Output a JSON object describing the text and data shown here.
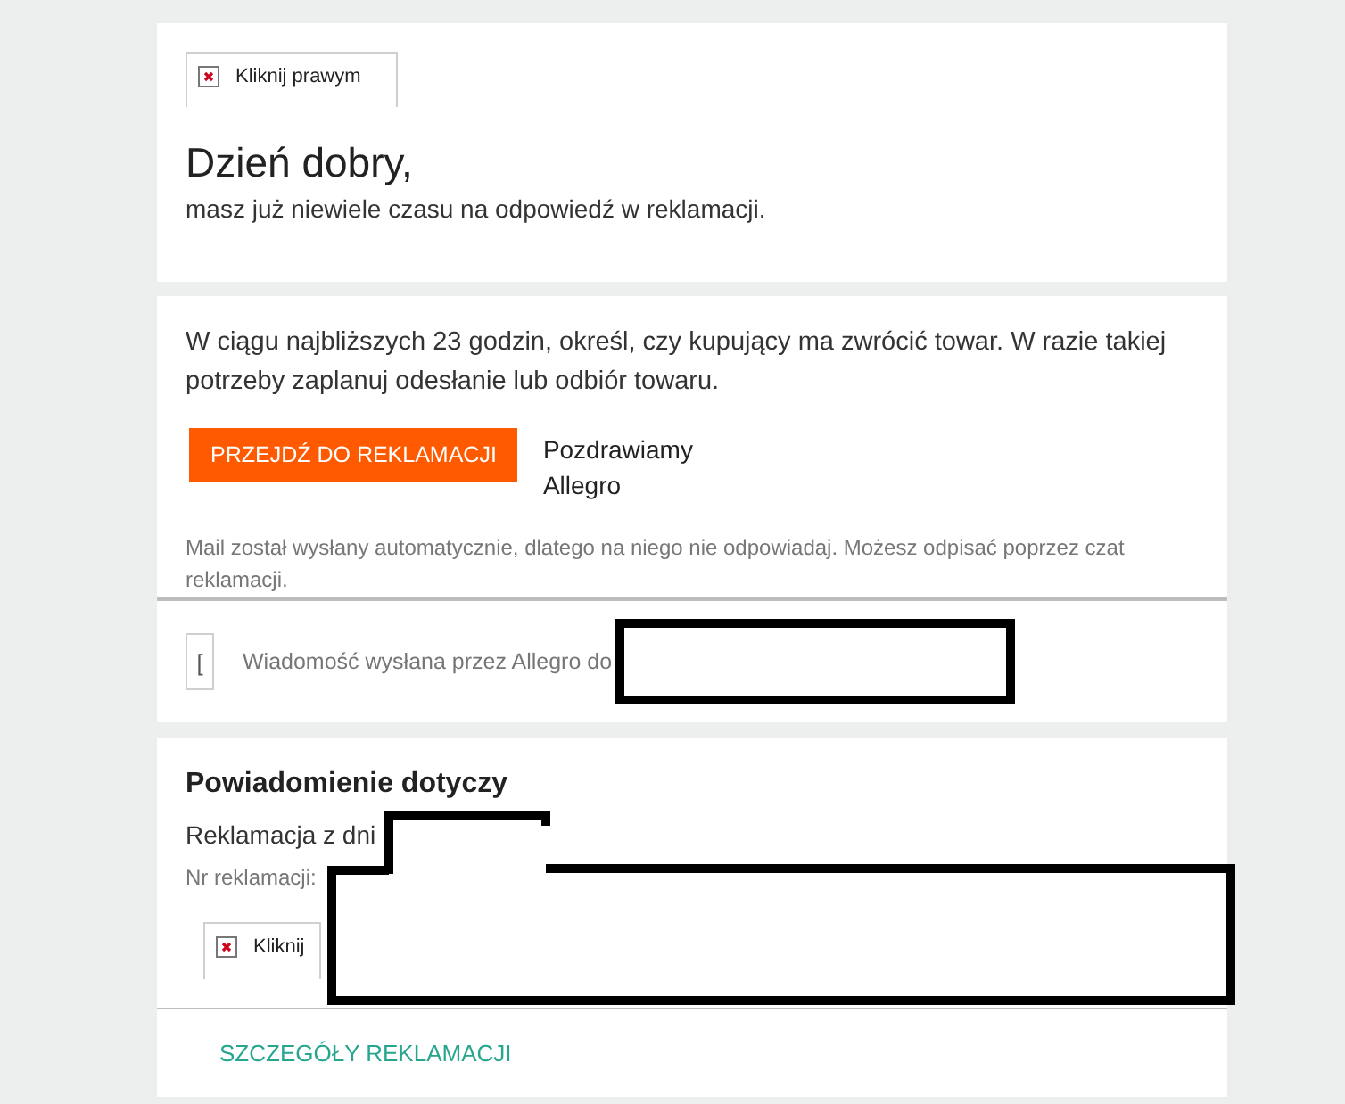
{
  "greeting_card": {
    "image_alt": "Kliknij prawym",
    "title": "Dzień dobry,",
    "subtitle": "masz już niewiele czasu na odpowiedź w reklamacji."
  },
  "message_card": {
    "body": "W ciągu najbliższych 23 godzin, określ, czy kupujący ma zwrócić towar. W razie takiej potrzeby zaplanuj odesłanie lub odbiór towaru.",
    "button": "PRZEJDŹ DO REKLAMACJI",
    "signoff": [
      "Pozdrawiamy",
      "Allegro"
    ],
    "footer_note": "Mail został wysłany automatycznie, dlatego na niego nie odpowiadaj. Możesz odpisać poprzez czat reklamacji."
  },
  "sender_row": {
    "image_alt": "[",
    "text": "Wiadomość wysłana przez Allegro do"
  },
  "details_card": {
    "title": "Powiadomienie dotyczy",
    "claim_date": "Reklamacja z dni",
    "claim_number": "Nr reklamacji:",
    "image_alt": "Kliknij",
    "link": "SZCZEGÓŁY REKLAMACJI"
  }
}
